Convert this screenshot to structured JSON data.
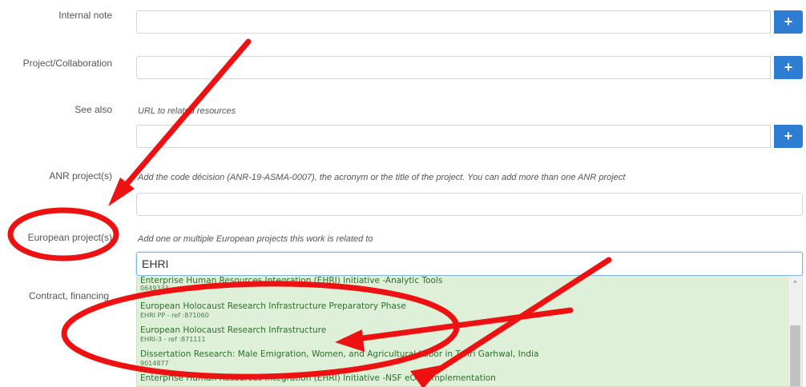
{
  "fields": {
    "internal_note": {
      "label": "Internal note"
    },
    "project_collab": {
      "label": "Project/Collaboration"
    },
    "see_also": {
      "label": "See also",
      "help": "URL to related resources"
    },
    "anr": {
      "label": "ANR project(s)",
      "help": "Add the code décision (ANR-19-ASMA-0007), the acronym or the title of the project. You can add more than one ANR project"
    },
    "european": {
      "label": "European project(s)",
      "help": "Add one or multiple European projects this work is related to",
      "value": "EHRI"
    },
    "contract": {
      "label": "Contract, financing"
    }
  },
  "add_button_label": "+",
  "suggestions": [
    {
      "title": "Enterprise Human Resources Integration (EHRI) Initiative -Analytic Tools",
      "sub": "0649333"
    },
    {
      "title": "European Holocaust Research Infrastructure Preparatory Phase",
      "sub": "EHRI PP - ref :871060"
    },
    {
      "title": "European Holocaust Research Infrastructure",
      "sub": "EHRI-3 - ref :871111"
    },
    {
      "title": "Dissertation Research: Male Emigration, Women, and Agricultural Labor in Tehri Garhwal, India",
      "sub": "9014877"
    },
    {
      "title": "Enterprise Human Resources Integration (EHRI) Initiative -NSF eOPF Implementation",
      "sub": ""
    }
  ],
  "scroll_up_glyph": "^",
  "colors": {
    "accent_button": "#2d7dd2",
    "annotation_red": "#ee1111",
    "suggestion_bg": "#dff0d8"
  }
}
